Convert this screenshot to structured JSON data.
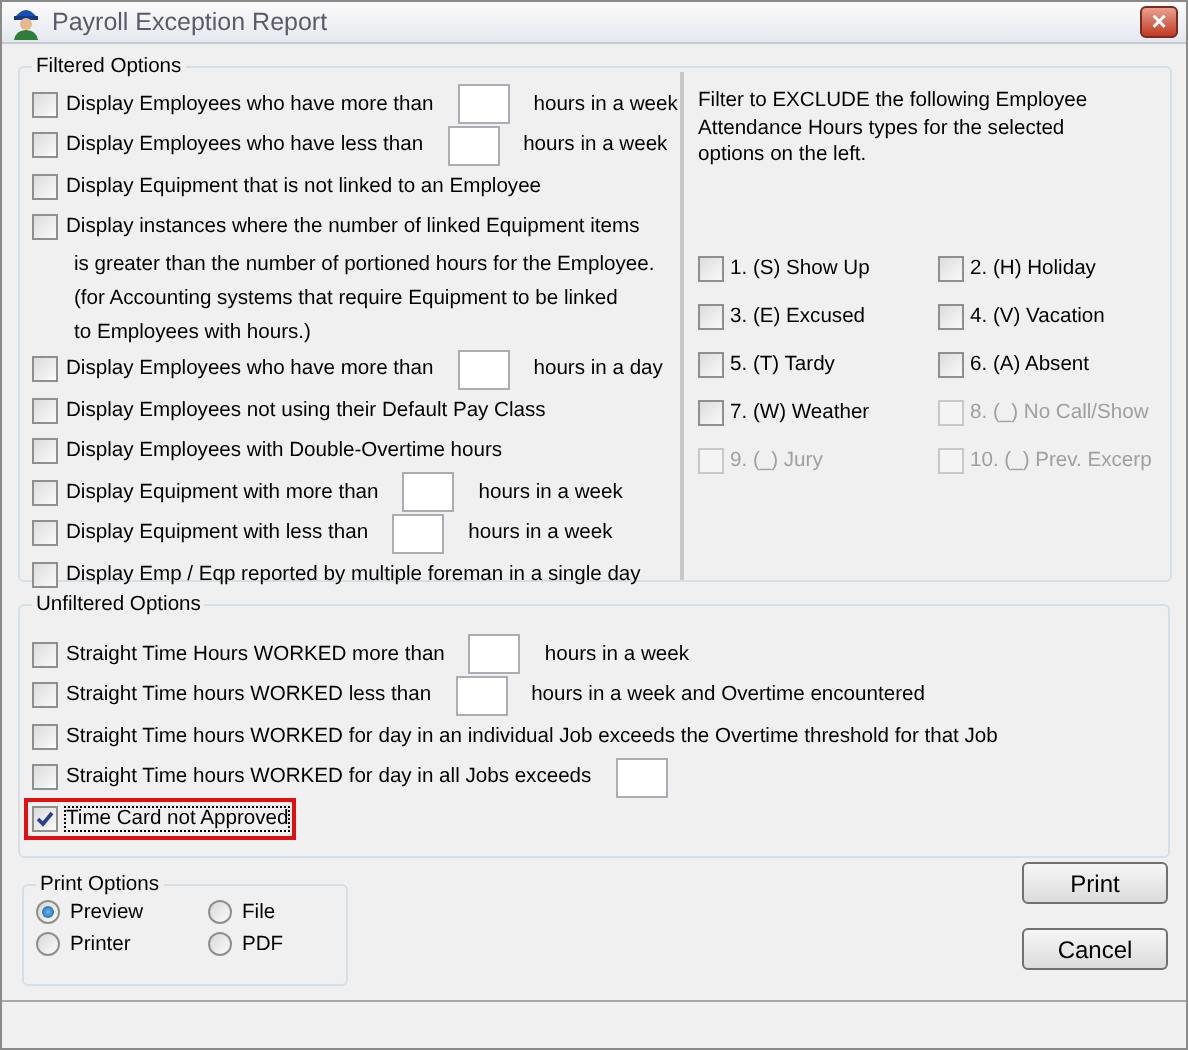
{
  "window": {
    "title": "Payroll Exception Report",
    "close_button": "×"
  },
  "filtered_options": {
    "title": "Filtered Options",
    "items": [
      {
        "kind": "input",
        "label": "Display Employees who have more than",
        "suffix": "hours in a week",
        "checked": false
      },
      {
        "kind": "input",
        "label": "Display Employees who have less than",
        "suffix": "hours in a week",
        "checked": false
      },
      {
        "kind": "plain",
        "label": "Display Equipment that is not linked to an Employee",
        "checked": false
      },
      {
        "kind": "multiline",
        "lines": [
          "Display instances where the number of linked Equipment items",
          "is greater than the number of portioned hours for the Employee.",
          "(for Accounting systems that require Equipment to be linked",
          "to Employees with hours.)"
        ],
        "checked": false
      },
      {
        "kind": "input",
        "label": "Display Employees who have more than",
        "suffix": "hours in a day",
        "checked": false
      },
      {
        "kind": "plain",
        "label": "Display Employees not using their Default Pay Class",
        "checked": false
      },
      {
        "kind": "plain",
        "label": "Display Employees with Double-Overtime hours",
        "checked": false
      },
      {
        "kind": "input",
        "label": "Display Equipment with more than",
        "suffix": "hours in a week",
        "checked": false
      },
      {
        "kind": "input",
        "label": "Display Equipment with less than",
        "suffix": "hours in a week",
        "checked": false
      },
      {
        "kind": "plain",
        "label": "Display Emp / Eqp reported by multiple foreman in a single day",
        "checked": false
      }
    ]
  },
  "attendance_filter": {
    "note_lines": [
      "Filter to EXCLUDE the following Employee",
      "Attendance Hours types for the selected",
      "options on the left."
    ],
    "types": [
      {
        "label": "1. (S) Show Up",
        "checked": false,
        "disabled": false
      },
      {
        "label": "2. (H) Holiday",
        "checked": false,
        "disabled": false
      },
      {
        "label": "3. (E) Excused",
        "checked": false,
        "disabled": false
      },
      {
        "label": "4. (V) Vacation",
        "checked": false,
        "disabled": false
      },
      {
        "label": "5. (T) Tardy",
        "checked": false,
        "disabled": false
      },
      {
        "label": "6. (A) Absent",
        "checked": false,
        "disabled": false
      },
      {
        "label": "7. (W) Weather",
        "checked": false,
        "disabled": false
      },
      {
        "label": "8. (_) No Call/Show",
        "checked": false,
        "disabled": true
      },
      {
        "label": "9. (_) Jury",
        "checked": false,
        "disabled": true
      },
      {
        "label": "10. (_) Prev. Excerp",
        "checked": false,
        "disabled": true
      }
    ]
  },
  "unfiltered_options": {
    "title": "Unfiltered Options",
    "items": [
      {
        "kind": "input",
        "label": "Straight Time Hours WORKED more than",
        "suffix": "hours in a week",
        "checked": false,
        "highlighted": false
      },
      {
        "kind": "input",
        "label": "Straight Time hours WORKED less than",
        "suffix": "hours in a week and Overtime encountered",
        "checked": false,
        "highlighted": false
      },
      {
        "kind": "plain",
        "label": "Straight Time hours WORKED for day in an individual Job exceeds the Overtime threshold for that Job",
        "checked": false,
        "highlighted": false
      },
      {
        "kind": "input",
        "label": "Straight Time hours WORKED for day in all Jobs exceeds",
        "checked": false,
        "highlighted": false
      },
      {
        "kind": "plain",
        "label": "Time Card not Approved",
        "checked": true,
        "highlighted": true
      }
    ]
  },
  "print_options": {
    "title": "Print Options",
    "choices": [
      {
        "label": "Preview",
        "selected": true
      },
      {
        "label": "File",
        "selected": false
      },
      {
        "label": "Printer",
        "selected": false
      },
      {
        "label": "PDF",
        "selected": false
      }
    ]
  },
  "buttons": [
    "Print",
    "Cancel"
  ]
}
